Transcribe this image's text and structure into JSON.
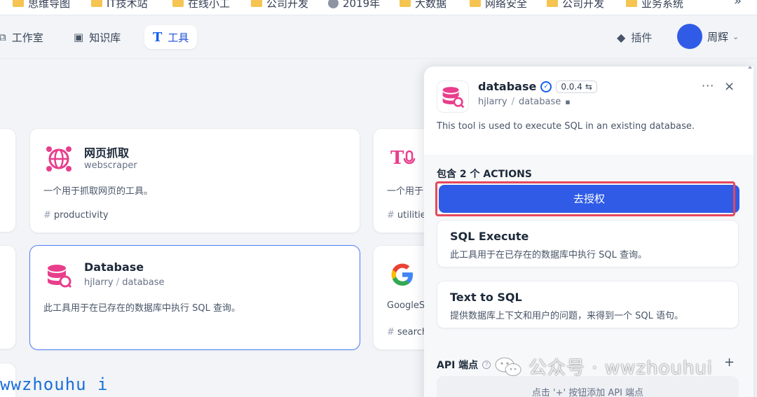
{
  "bookmarks": [
    {
      "label": "思维导图",
      "icon": "folder-icon"
    },
    {
      "label": "IT技术站",
      "icon": "folder-icon"
    },
    {
      "label": "在线小工",
      "icon": "folder-icon"
    },
    {
      "label": "公司开发",
      "icon": "folder-icon"
    },
    {
      "label": "2019年",
      "icon": "globe-icon"
    },
    {
      "label": "大数据",
      "icon": "folder-icon"
    },
    {
      "label": "网络安全",
      "icon": "folder-icon"
    },
    {
      "label": "公司开发",
      "icon": "folder-icon"
    },
    {
      "label": "业务系统",
      "icon": "folder-icon"
    }
  ],
  "bookmarks_more": "»",
  "nav": {
    "studio": "工作室",
    "knowledge": "知识库",
    "tools": "工具",
    "plugins": "插件",
    "user": "周辉"
  },
  "cards": [
    {
      "title": "网页抓取",
      "sub": "webscraper",
      "desc": "一个用于抓取网页的工具。",
      "tag": "productivity"
    },
    {
      "title": "Database",
      "author": "hjlarry",
      "slug": "database",
      "desc": "此工具用于在已存在的数据库中执行 SQL 查询。"
    },
    {
      "desc": "一个用于",
      "tag": "utilitie"
    },
    {
      "desc": "GoogleS",
      "tag": "search"
    }
  ],
  "panel": {
    "name": "database",
    "version": "0.0.4",
    "author": "hjlarry",
    "slug": "database",
    "description": "This tool is used to execute SQL in an existing database.",
    "more": "···",
    "close": "×",
    "actions_title": "包含 2 个 ACTIONS",
    "auth_button": "去授权",
    "actions": [
      {
        "name": "SQL Execute",
        "desc": "此工具用于在已存在的数据库中执行 SQL 查询。"
      },
      {
        "name": "Text to SQL",
        "desc": "提供数据库上下文和用户的问题，来得到一个 SQL 语句。"
      }
    ],
    "api_title": "API 端点",
    "api_add": "+",
    "api_hint": "点击 '+' 按钮添加 API 端点"
  },
  "watermark": "公众号 · wwzhouhui",
  "overlay_text": "wwzhouhu i",
  "colors": {
    "accent": "#2f5be7",
    "highlight": "#e5485d",
    "db_pink": "#e83e8c"
  }
}
